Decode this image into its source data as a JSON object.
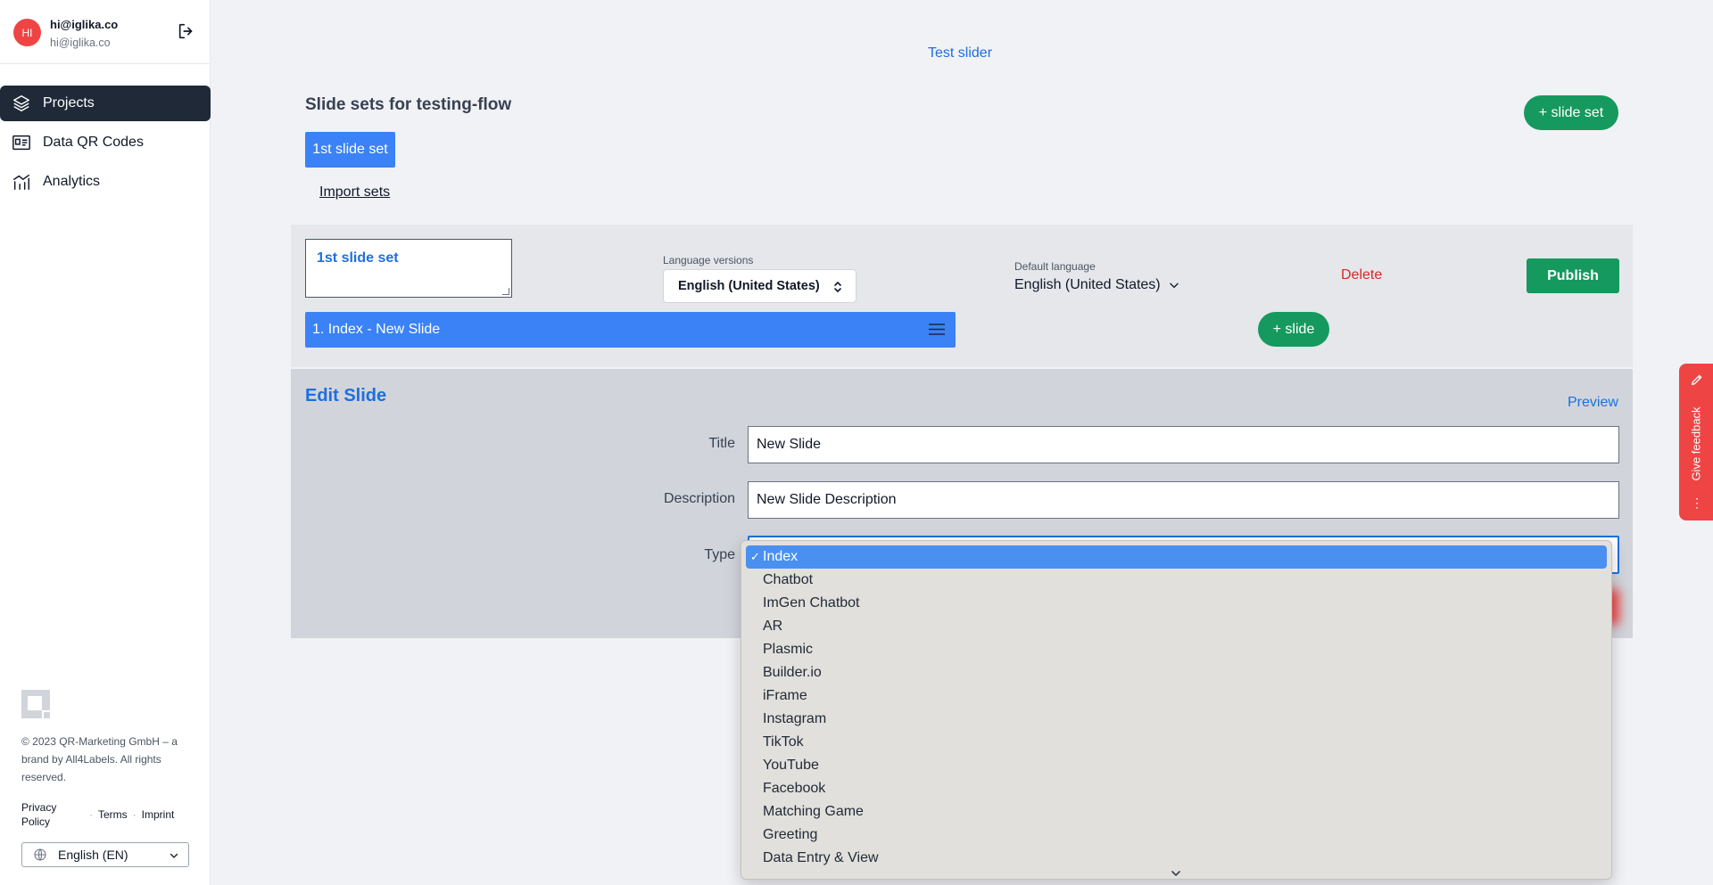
{
  "user": {
    "initials": "HI",
    "name": "hi@iglika.co",
    "email": "hi@iglika.co"
  },
  "sidebar": {
    "items": [
      {
        "label": "Projects",
        "icon": "layers-icon",
        "active": true
      },
      {
        "label": "Data QR Codes",
        "icon": "id-card-icon",
        "active": false
      },
      {
        "label": "Analytics",
        "icon": "analytics-icon",
        "active": false
      }
    ],
    "copyright": "© 2023 QR-Marketing GmbH – a brand by All4Labels. All rights reserved.",
    "links": {
      "privacy": "Privacy Policy",
      "sep1": "·",
      "terms": "Terms",
      "sep2": "·",
      "imprint": "Imprint"
    },
    "language": "English (EN)"
  },
  "main": {
    "test_slider": "Test slider",
    "sets_title": "Slide sets for testing-flow",
    "add_set_label": "+ slide set",
    "set_tab_label": "1st slide set",
    "import_sets": "Import sets",
    "set_name_value": "1st slide set",
    "language_versions_label": "Language versions",
    "language_versions_value": "English (United States)",
    "default_language_label": "Default language",
    "default_language_value": "English (United States)",
    "delete_label": "Delete",
    "publish_label": "Publish",
    "slide_row_label": "1. Index - New Slide",
    "add_slide_label": "+ slide"
  },
  "edit": {
    "title": "Edit Slide",
    "preview": "Preview",
    "title_label": "Title",
    "title_value": "New Slide",
    "description_label": "Description",
    "description_value": "New Slide Description",
    "type_label": "Type"
  },
  "type_dropdown": {
    "selected": "Index",
    "check": "✓",
    "options": [
      "Index",
      "Chatbot",
      "ImGen Chatbot",
      "AR",
      "Plasmic",
      "Builder.io",
      "iFrame",
      "Instagram",
      "TikTok",
      "YouTube",
      "Facebook",
      "Matching Game",
      "Greeting",
      "Data Entry & View"
    ]
  },
  "feedback": {
    "label": "Give feedback",
    "dots": "⋮"
  },
  "colors": {
    "accent_blue": "#3b82f6",
    "link_blue": "#1d6fe0",
    "green": "#15995e",
    "red": "#dc2626",
    "sidebar_active": "#1f2937"
  }
}
